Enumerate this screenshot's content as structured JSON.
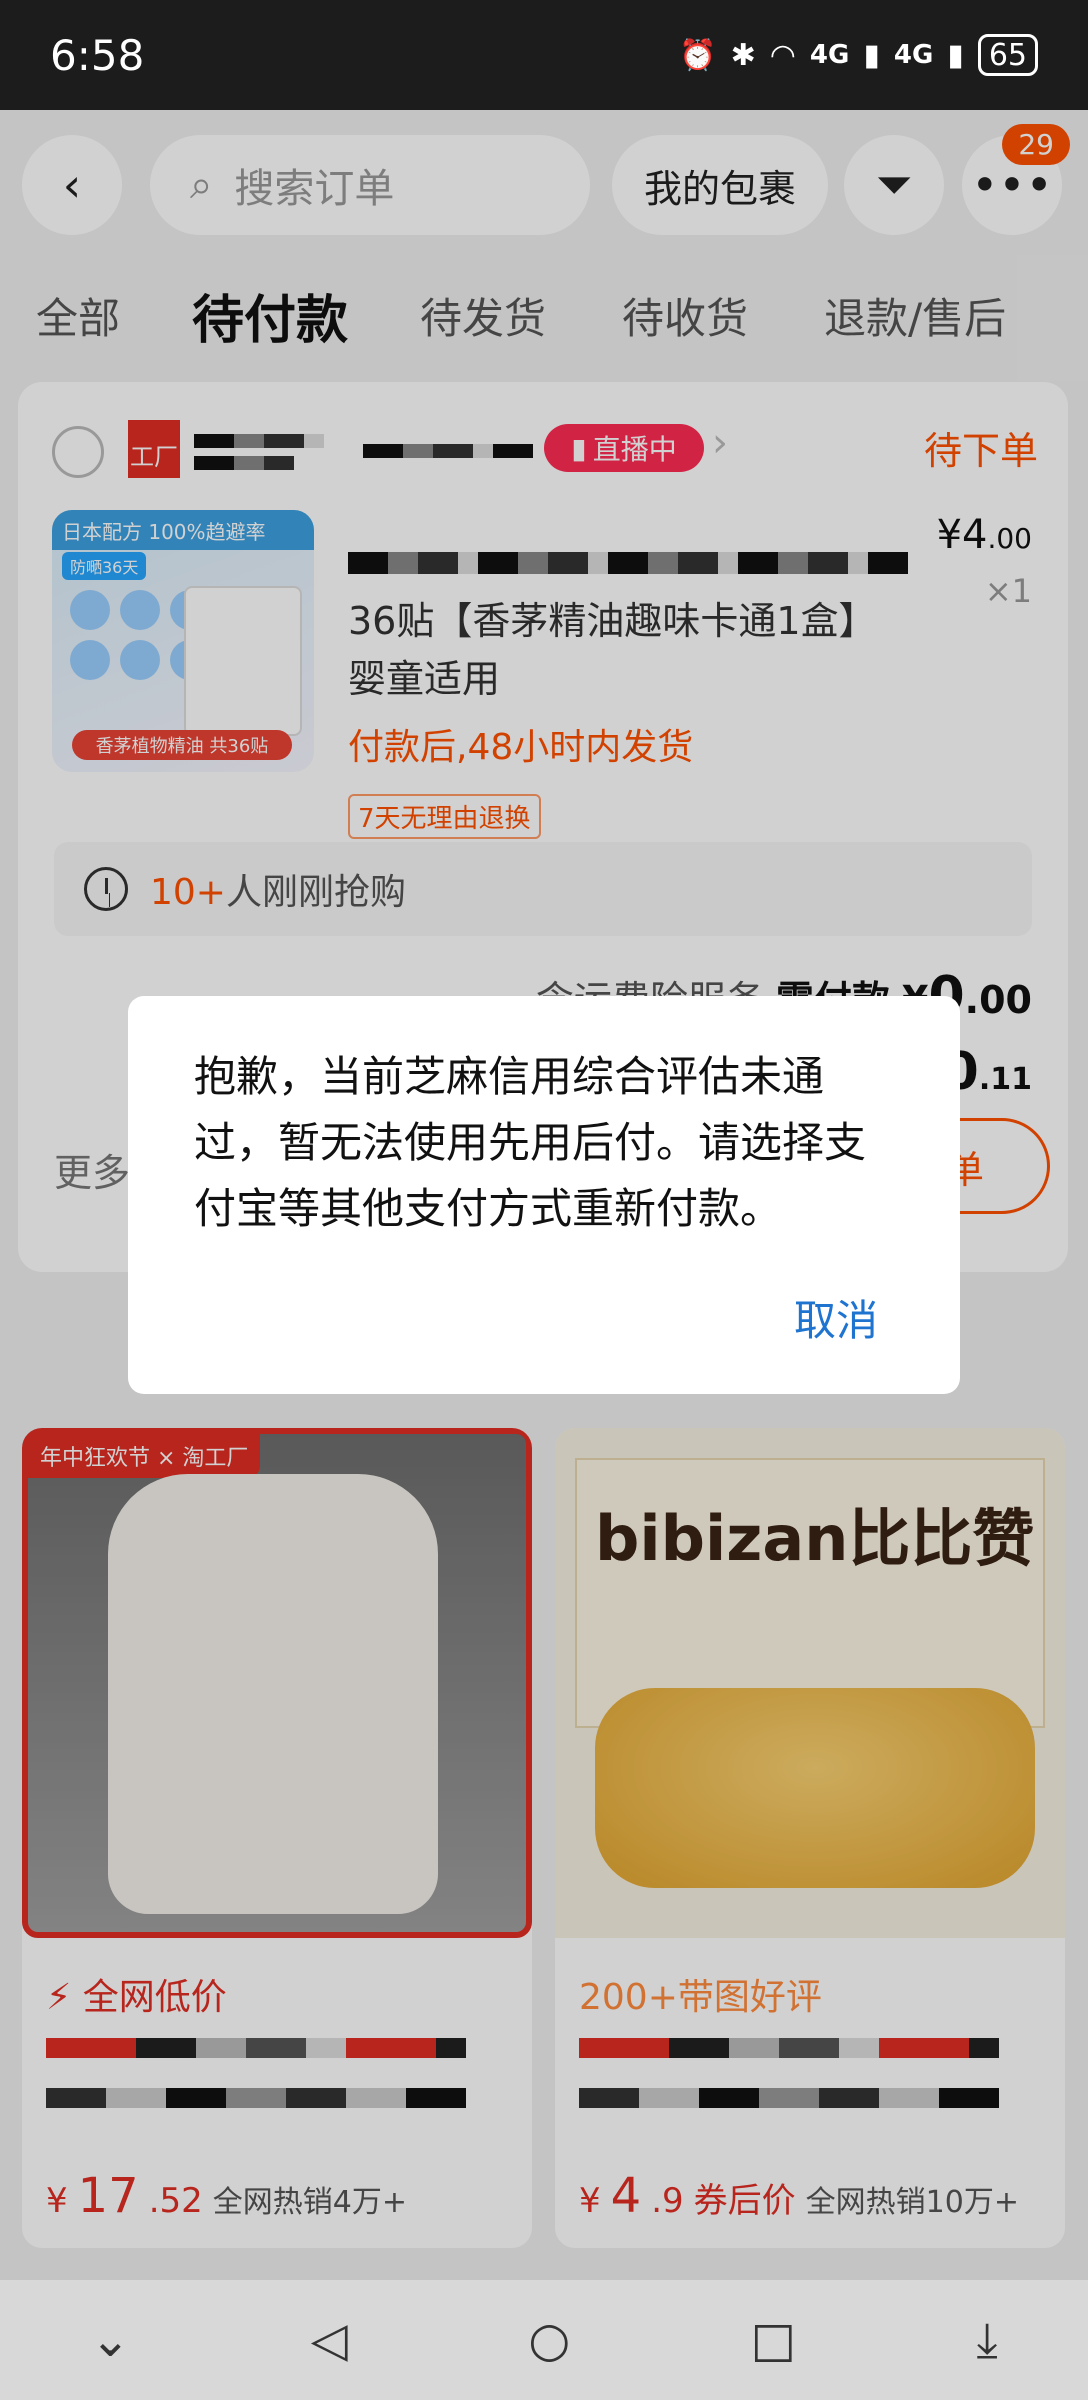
{
  "status_bar": {
    "time": "6:58",
    "signal1": "4G",
    "signal2": "4G",
    "battery": "65"
  },
  "header": {
    "search_placeholder": "搜索订单",
    "my_packages": "我的包裹",
    "badge_count": "29"
  },
  "tabs": [
    "全部",
    "待付款",
    "待发货",
    "待收货",
    "退款/售后"
  ],
  "order": {
    "factory_label": "工厂",
    "live_label": "直播中",
    "status": "待下单",
    "image_top_text": "日本配方 100%趋避率",
    "image_tag": "防嗮36天",
    "image_bottom_text": "香茅植物精油  共36贴",
    "price_symbol": "¥",
    "price_int": "4",
    "price_dec": ".00",
    "quantity": "×1",
    "title": "36贴【香茅精油趣味卡通1盒】婴童适用",
    "shipping": "付款后,48小时内发货",
    "return_tag": "7天无理由退换",
    "hot_count": "10+",
    "hot_text": "人刚刚抢购",
    "fee_label": "含运费险服务",
    "fee_need": "需付款",
    "fee_symbol": "¥",
    "fee_int": "0",
    "fee_dec": ".00",
    "total_symbol": "¥",
    "total_int": "0",
    "total_dec": ".11",
    "more_label": "更多",
    "pay_button": "单"
  },
  "recommend": [
    {
      "flag": "年中狂欢节 × 淘工厂",
      "label": "全网低价",
      "price_symbol": "¥",
      "price_int": "17",
      "price_dec": ".52",
      "sales": "全网热销4万+"
    },
    {
      "brand": "bibizan比比赞",
      "label": "200+带图好评",
      "price_symbol": "¥",
      "price_int": "4",
      "price_dec": ".9",
      "coupon": "券后价",
      "sales": "全网热销10万+"
    }
  ],
  "dialog": {
    "message": "抱歉，当前芝麻信用综合评估未通过，暂无法使用先用后付。请选择支付宝等其他支付方式重新付款。",
    "cancel": "取消"
  }
}
